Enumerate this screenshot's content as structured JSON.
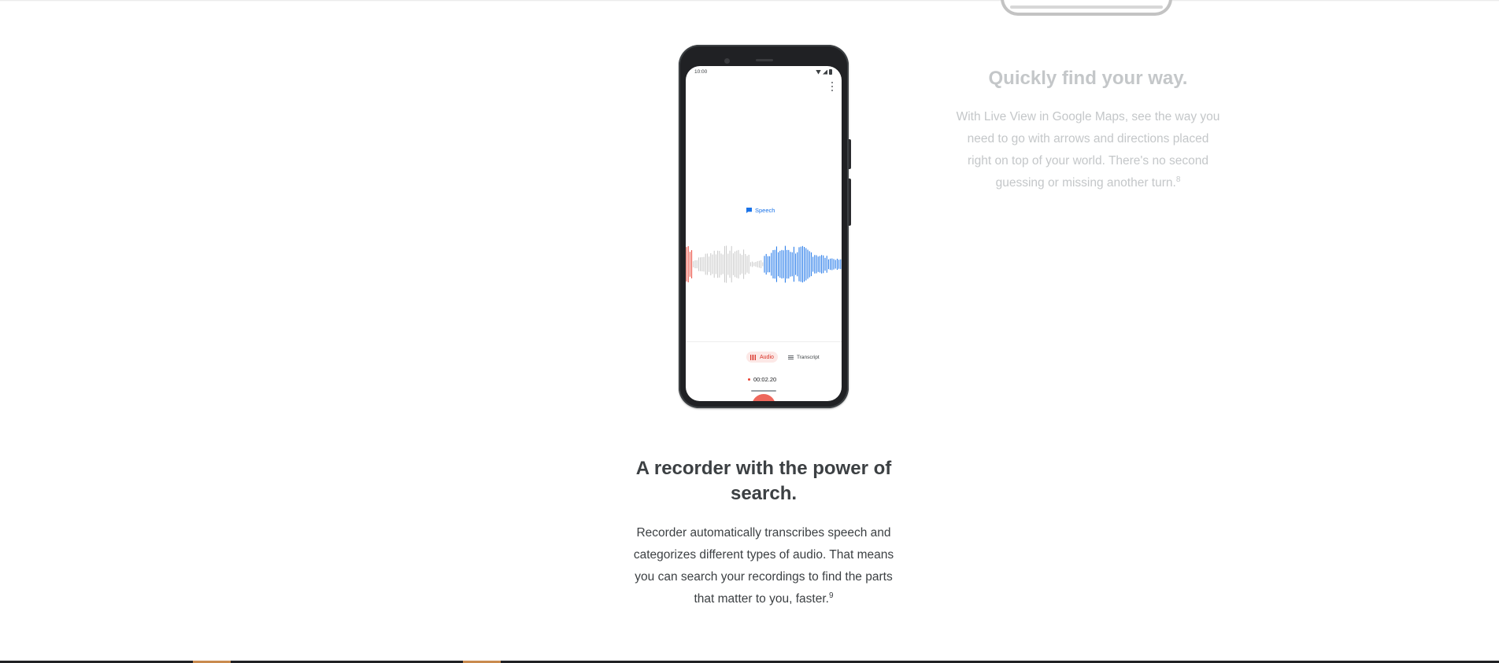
{
  "recorder_feature": {
    "phone": {
      "status_time": "10:00",
      "speech_label": "Speech",
      "audio_tab_label": "Audio",
      "transcript_tab_label": "Transcript",
      "timer": "00:02.20"
    },
    "title": "A recorder with the power of search.",
    "body": "Recorder automatically transcribes speech and categorizes different types of audio. That means you can search your recordings to find the parts that matter to you, faster.",
    "footnote": "9"
  },
  "maps_feature": {
    "title": "Quickly find your way.",
    "body": "With Live View in Google Maps, see the way you need to go with arrows and directions placed right on top of your world. There's no second guessing or missing another turn.",
    "footnote": "8"
  },
  "colors": {
    "recording_accent": "#ea4335",
    "speech_accent": "#1a73e8",
    "waveform_past": "#c9c9c9",
    "heading_text": "#3c4043",
    "faded_text": "#c4c7c9"
  },
  "icons": {
    "speech": "speech-flag-icon",
    "audio": "audio-wave-icon",
    "transcript": "transcript-lines-icon",
    "pause": "pause-icon",
    "more": "more-vert-icon"
  }
}
